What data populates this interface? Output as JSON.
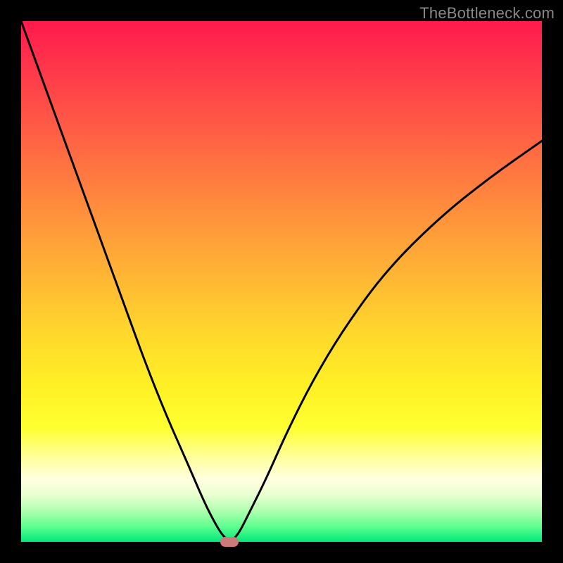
{
  "watermark": "TheBottleneck.com",
  "chart_data": {
    "type": "line",
    "title": "",
    "xlabel": "",
    "ylabel": "",
    "xlim": [
      0,
      100
    ],
    "ylim": [
      0,
      100
    ],
    "x": [
      0,
      4,
      8,
      12,
      16,
      20,
      24,
      28,
      32,
      35,
      37,
      38.5,
      39.5,
      40,
      40.8,
      42,
      44,
      47,
      51,
      56,
      62,
      70,
      80,
      90,
      100
    ],
    "y": [
      100,
      89,
      78,
      67,
      56,
      45,
      34,
      24,
      15,
      8,
      4,
      1.5,
      0.5,
      0,
      0.5,
      2,
      6,
      12,
      21,
      31,
      41,
      52,
      62,
      70,
      77
    ],
    "marker": {
      "x": 40,
      "y": 0
    },
    "gradient_stops": [
      {
        "pos": 0.0,
        "color": "#ff1a4d"
      },
      {
        "pos": 0.5,
        "color": "#ffb933"
      },
      {
        "pos": 0.78,
        "color": "#ffff30"
      },
      {
        "pos": 1.0,
        "color": "#00e878"
      }
    ]
  }
}
